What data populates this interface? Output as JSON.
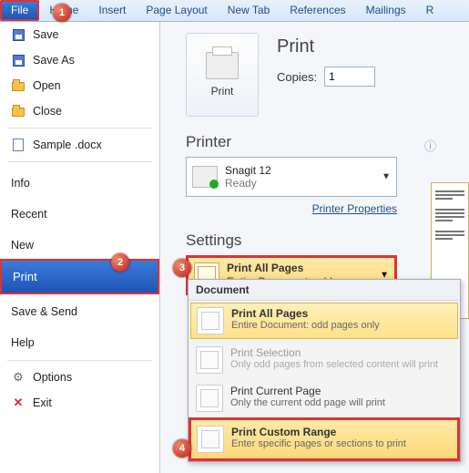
{
  "ribbon": {
    "tabs": [
      "File",
      "Home",
      "Insert",
      "Page Layout",
      "New Tab",
      "References",
      "Mailings",
      "R"
    ]
  },
  "backstage": {
    "save": "Save",
    "save_as": "Save As",
    "open": "Open",
    "close": "Close",
    "sample": "Sample .docx",
    "info": "Info",
    "recent": "Recent",
    "new": "New",
    "print": "Print",
    "save_send": "Save & Send",
    "help": "Help",
    "options": "Options",
    "exit": "Exit"
  },
  "print": {
    "button": "Print",
    "heading": "Print",
    "copies_label": "Copies:",
    "copies_value": "1"
  },
  "printer": {
    "heading": "Printer",
    "name": "Snagit 12",
    "status": "Ready",
    "props_link": "Printer Properties"
  },
  "settings": {
    "heading": "Settings",
    "sel_title": "Print All Pages",
    "sel_sub": "Entire Document: odd page..."
  },
  "dropdown": {
    "section": "Document",
    "opts": [
      {
        "title": "Print All Pages",
        "sub": "Entire Document: odd pages only"
      },
      {
        "title": "Print Selection",
        "sub": "Only odd pages from selected content will print"
      },
      {
        "title": "Print Current Page",
        "sub": "Only the current odd page will print"
      },
      {
        "title": "Print Custom Range",
        "sub": "Enter specific pages or sections to print"
      }
    ]
  },
  "callouts": {
    "c1": "1",
    "c2": "2",
    "c3": "3",
    "c4": "4"
  }
}
